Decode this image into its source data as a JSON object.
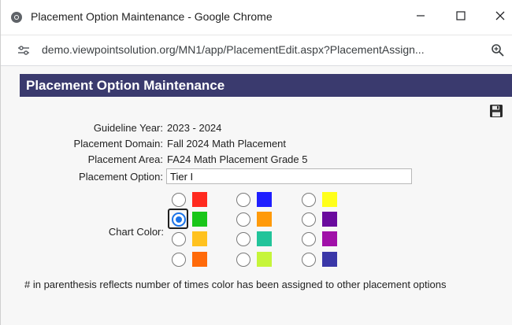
{
  "window": {
    "title": "Placement Option Maintenance - Google Chrome",
    "url": "demo.viewpointsolution.org/MN1/app/PlacementEdit.aspx?PlacementAssign..."
  },
  "icons": {
    "chrome": "chrome-icon",
    "minimize": "minimize-icon",
    "maximize": "maximize-icon",
    "close": "close-icon",
    "site_settings": "tune-icon",
    "zoom": "zoom-icon",
    "save": "floppy-disk-icon"
  },
  "page": {
    "header": "Placement Option Maintenance",
    "fields": {
      "guideline_year_label": "Guideline Year:",
      "guideline_year_value": "2023 - 2024",
      "placement_domain_label": "Placement Domain:",
      "placement_domain_value": "Fall 2024 Math Placement",
      "placement_area_label": "Placement Area:",
      "placement_area_value": "FA24 Math Placement Grade 5",
      "placement_option_label": "Placement Option:",
      "placement_option_value": "Tier I",
      "chart_color_label": "Chart Color:"
    },
    "colors": [
      {
        "hex": "#ff2a1f",
        "selected": false
      },
      {
        "hex": "#1f1fff",
        "selected": false
      },
      {
        "hex": "#ffff1a",
        "selected": false
      },
      {
        "hex": "#19c619",
        "selected": true
      },
      {
        "hex": "#ff9a0a",
        "selected": false
      },
      {
        "hex": "#6a0a9e",
        "selected": false
      },
      {
        "hex": "#ffc21f",
        "selected": false
      },
      {
        "hex": "#22c49a",
        "selected": false
      },
      {
        "hex": "#a010a8",
        "selected": false
      },
      {
        "hex": "#ff6a0a",
        "selected": false
      },
      {
        "hex": "#c6f53a",
        "selected": false
      },
      {
        "hex": "#3a37a8",
        "selected": false
      }
    ],
    "footnote": "# in parenthesis reflects number of times color has been assigned to other placement options"
  },
  "theme": {
    "header_bg": "#3a3a6e",
    "accent": "#1a73e8"
  }
}
